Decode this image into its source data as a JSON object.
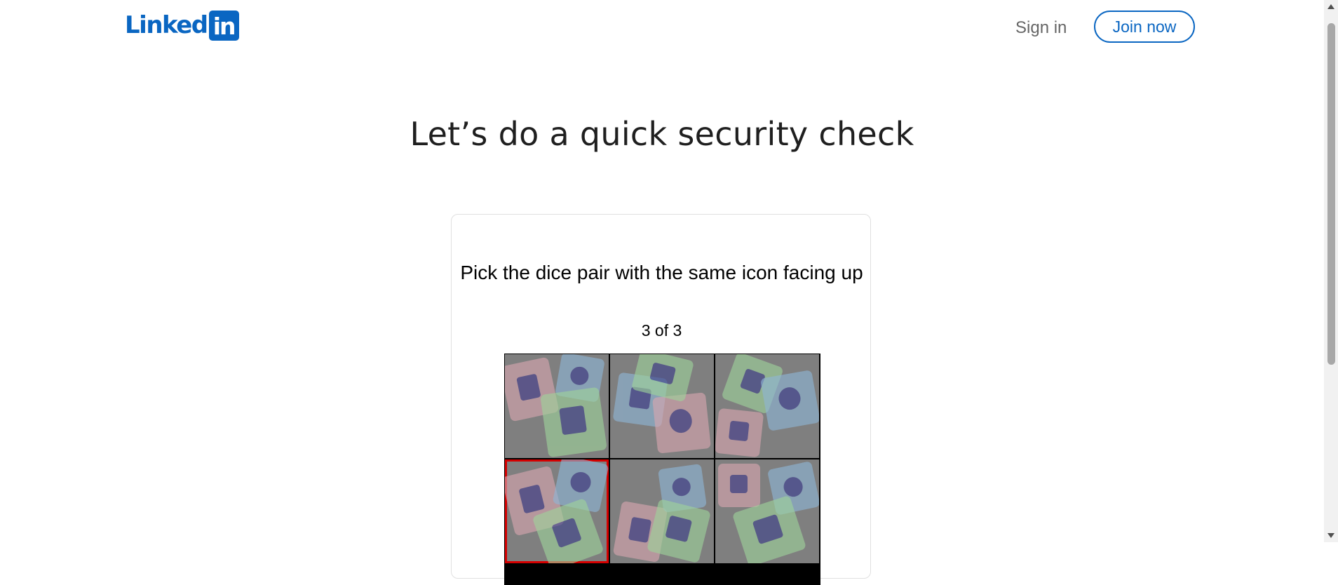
{
  "header": {
    "logo_text": "Linked",
    "logo_box_text": "in",
    "sign_in": "Sign in",
    "join_now": "Join now"
  },
  "page": {
    "title": "Let’s do a quick security check"
  },
  "challenge": {
    "prompt": "Pick the dice pair with the same icon facing up",
    "progress": "3 of 3",
    "selected_tile_index": 3,
    "tiles": [
      {
        "icon": "dice-group-1",
        "dice_colors": [
          "#d9a7b0",
          "#8fb6d6",
          "#9fd39b"
        ]
      },
      {
        "icon": "dice-group-2",
        "dice_colors": [
          "#8fb6d6",
          "#d9a7b0",
          "#9fd39b"
        ]
      },
      {
        "icon": "dice-group-3",
        "dice_colors": [
          "#9fd39b",
          "#8fb6d6",
          "#d9a7b0"
        ]
      },
      {
        "icon": "dice-group-4",
        "dice_colors": [
          "#d9a7b0",
          "#8fb6d6",
          "#9fd39b"
        ]
      },
      {
        "icon": "dice-group-5",
        "dice_colors": [
          "#d9a7b0",
          "#8fb6d6",
          "#9fd39b"
        ]
      },
      {
        "icon": "dice-group-6",
        "dice_colors": [
          "#d9a7b0",
          "#8fb6d6",
          "#9fd39b"
        ]
      }
    ]
  },
  "colors": {
    "brand": "#0a66c2",
    "selection": "#d50000",
    "tile_background": "#7f7f7f"
  }
}
